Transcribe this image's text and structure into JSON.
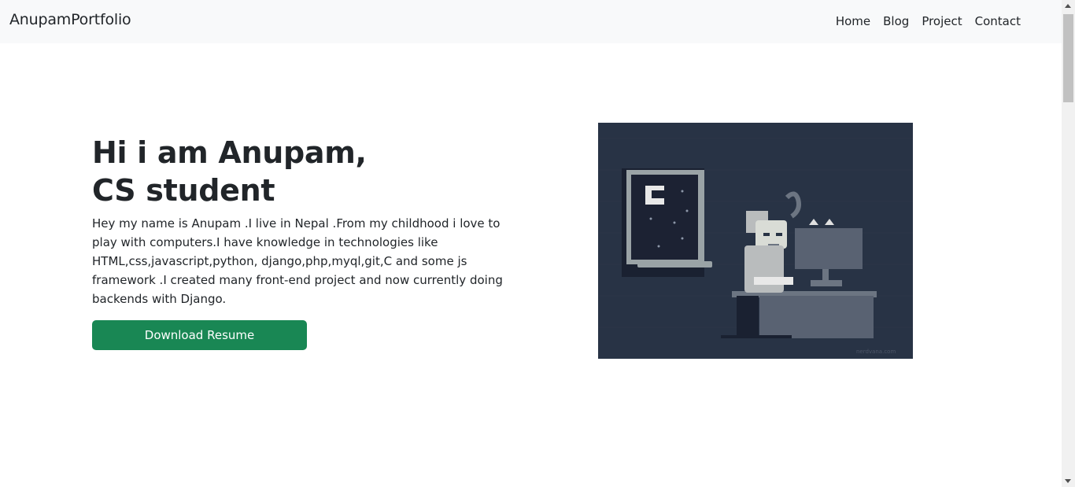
{
  "navbar": {
    "brand": "AnupamPortfolio",
    "links": [
      "Home",
      "Blog",
      "Project",
      "Contact"
    ]
  },
  "hero": {
    "title_line1": "Hi i am Anupam,",
    "title_line2": "CS student",
    "description": "Hey my name is Anupam .I live in Nepal .From my childhood i love to play with computers.I have knowledge in technologies like HTML,css,javascript,python, django,php,myql,git,C and some js framework .I created many front-end project and now currently doing backends with Django.",
    "button_label": "Download Resume"
  },
  "illustration": {
    "icon": "person-at-computer-illustration"
  },
  "colors": {
    "navbar_bg": "#f8f9fa",
    "button_bg": "#198754",
    "illustration_bg": "#283345"
  }
}
